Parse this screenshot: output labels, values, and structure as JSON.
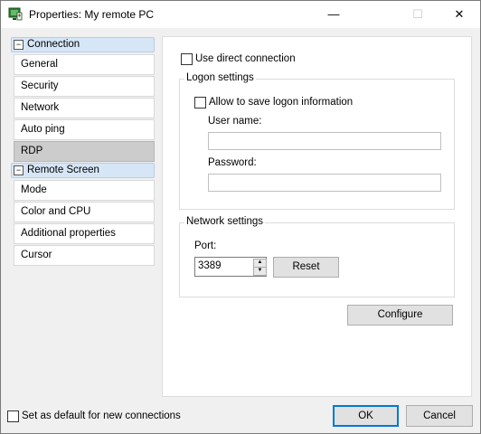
{
  "window": {
    "title": "Properties: My remote PC",
    "minimize_glyph": "—",
    "maximize_glyph": "☐",
    "close_glyph": "✕"
  },
  "sidebar": {
    "groups": [
      {
        "label": "Connection",
        "items": [
          "General",
          "Security",
          "Network",
          "Auto ping",
          "RDP"
        ]
      },
      {
        "label": "Remote Screen",
        "items": [
          "Mode",
          "Color and CPU",
          "Additional properties",
          "Cursor"
        ]
      }
    ],
    "selected_item": "RDP",
    "collapse_glyph": "−"
  },
  "rdp": {
    "use_direct_connection": {
      "label": "Use direct connection",
      "checked": false
    },
    "logon_settings": {
      "legend": "Logon settings",
      "allow_save": {
        "label": "Allow to save logon information",
        "checked": false
      },
      "user_name_label": "User name:",
      "user_name_value": "",
      "password_label": "Password:",
      "password_value": ""
    },
    "network_settings": {
      "legend": "Network settings",
      "port_label": "Port:",
      "port_value": "3389",
      "reset_label": "Reset"
    },
    "configure_label": "Configure"
  },
  "footer": {
    "default_checkbox": {
      "label": "Set as default for new connections",
      "checked": false
    },
    "ok_label": "OK",
    "cancel_label": "Cancel"
  },
  "colors": {
    "accent": "#0078d7",
    "group_header_bg": "#d6e6f7",
    "selected_item_bg": "#cccccc"
  }
}
